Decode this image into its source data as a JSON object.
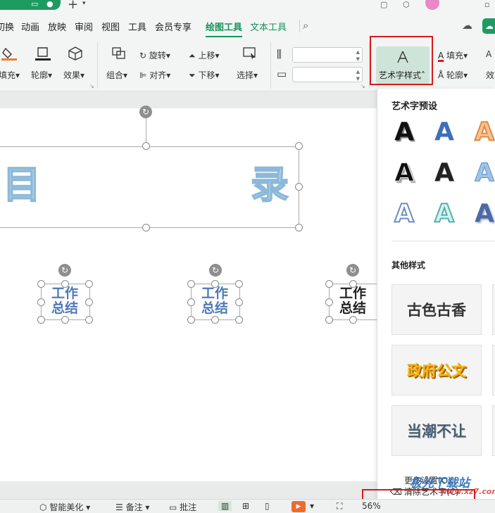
{
  "menu": {
    "tabs": [
      {
        "label": "切换"
      },
      {
        "label": "动画"
      },
      {
        "label": "放映"
      },
      {
        "label": "审阅"
      },
      {
        "label": "视图"
      },
      {
        "label": "工具"
      },
      {
        "label": "会员专享"
      },
      {
        "label": "绘图工具"
      },
      {
        "label": "文本工具"
      }
    ],
    "active_tab": "绘图工具"
  },
  "ribbon": {
    "fill": "填充",
    "outline": "轮廓",
    "effect": "效果",
    "group": "组合",
    "align": "对齐",
    "rotate": "旋转",
    "bring_forward": "上移",
    "send_backward": "下移",
    "select": "选择",
    "width_value": "",
    "height_value": "",
    "wordart_style": "艺术字样式",
    "text_fill": "填充",
    "text_outline": "轮廓",
    "text_effect": "效"
  },
  "slide": {
    "title_left_char": "目",
    "title_right_char": "录",
    "items": [
      {
        "line1": "工作",
        "line2": "总结",
        "color": "#4f78b8"
      },
      {
        "line1": "工作",
        "line2": "总结",
        "color": "#4f78b8"
      },
      {
        "line1": "工作",
        "line2": "总结",
        "color": "#222222"
      }
    ]
  },
  "panel": {
    "preset_title": "艺术字预设",
    "preset_glyph": "A",
    "other_title": "其他样式",
    "styles": [
      {
        "label": "古色古香",
        "color": "#333333"
      },
      {
        "label": "政府公文",
        "color": "#f5b814"
      },
      {
        "label": "当潮不让",
        "color": "#4a5d70"
      }
    ],
    "more_settings": "更多设置(O)...",
    "clear_wordart": "清除艺术字(C)"
  },
  "statusbar": {
    "beautify": "智能美化",
    "notes": "备注",
    "comment": "批注",
    "zoom": "56%"
  },
  "watermark": {
    "line1": "极光下载站",
    "line2": "www.xz7.com"
  },
  "colors": {
    "accent": "#15955a",
    "highlight_box": "#d9191c",
    "wordart_button_bg": "#cfe4d8"
  }
}
